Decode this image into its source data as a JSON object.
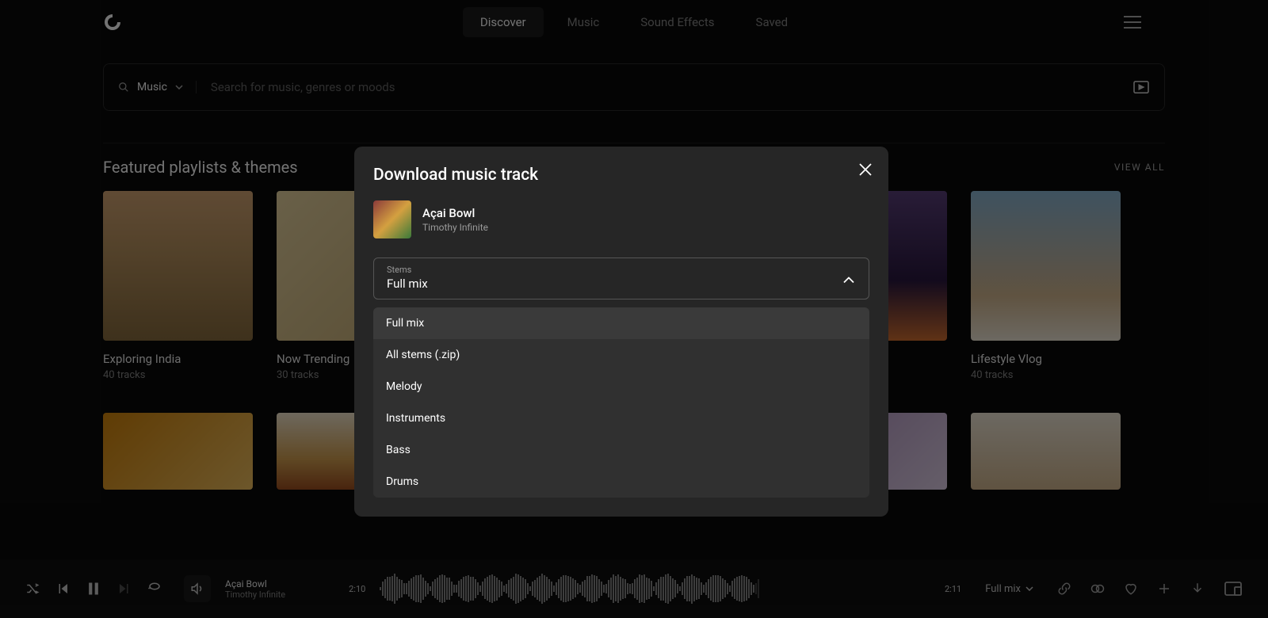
{
  "nav": {
    "items": [
      "Discover",
      "Music",
      "Sound Effects",
      "Saved"
    ],
    "active_index": 0
  },
  "search": {
    "category": "Music",
    "placeholder": "Search for music, genres or moods"
  },
  "section": {
    "title": "Featured playlists & themes",
    "view_all": "VIEW ALL"
  },
  "playlists": [
    {
      "title": "Exploring India",
      "sub": "40 tracks"
    },
    {
      "title": "Now Trending",
      "sub": "30 tracks"
    },
    {
      "title": "",
      "sub": ""
    },
    {
      "title": "",
      "sub": ""
    },
    {
      "title": "",
      "sub": ""
    },
    {
      "title": "Lifestyle Vlog",
      "sub": "40 tracks"
    }
  ],
  "modal": {
    "title": "Download music track",
    "track_name": "Açai Bowl",
    "track_artist": "Timothy Infinite",
    "stems_label": "Stems",
    "stems_value": "Full mix",
    "options": [
      "Full mix",
      "All stems (.zip)",
      "Melody",
      "Instruments",
      "Bass",
      "Drums"
    ]
  },
  "player": {
    "track_name": "Açai Bowl",
    "track_artist": "Timothy Infinite",
    "current_time": "2:10",
    "total_time": "2:11",
    "format": "Full mix"
  }
}
